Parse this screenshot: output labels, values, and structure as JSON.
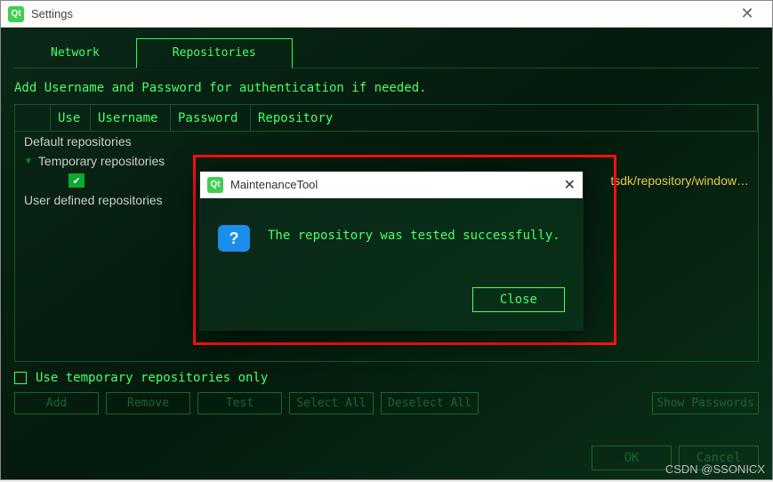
{
  "window": {
    "title": "Settings",
    "icon_label": "Qt"
  },
  "tabs": {
    "network": "Network",
    "repositories": "Repositories"
  },
  "instruction": "Add Username and Password for authentication if needed.",
  "table": {
    "headers": {
      "use": "Use",
      "username": "Username",
      "password": "Password",
      "repository": "Repository"
    },
    "rows": {
      "default": "Default repositories",
      "temporary": "Temporary repositories",
      "temp_url": "tsdk/repository/window…",
      "user_defined": "User defined repositories"
    }
  },
  "temp_check": "Use temporary repositories only",
  "buttons": {
    "add": "Add",
    "remove": "Remove",
    "test": "Test",
    "select_all": "Select All",
    "deselect_all": "Deselect All",
    "show_passwords": "Show Passwords",
    "ok": "OK",
    "cancel": "Cancel"
  },
  "dialog": {
    "title": "MaintenanceTool",
    "icon_label": "Qt",
    "message": "The repository was tested successfully.",
    "close": "Close"
  },
  "watermark": "CSDN @SSONICX"
}
